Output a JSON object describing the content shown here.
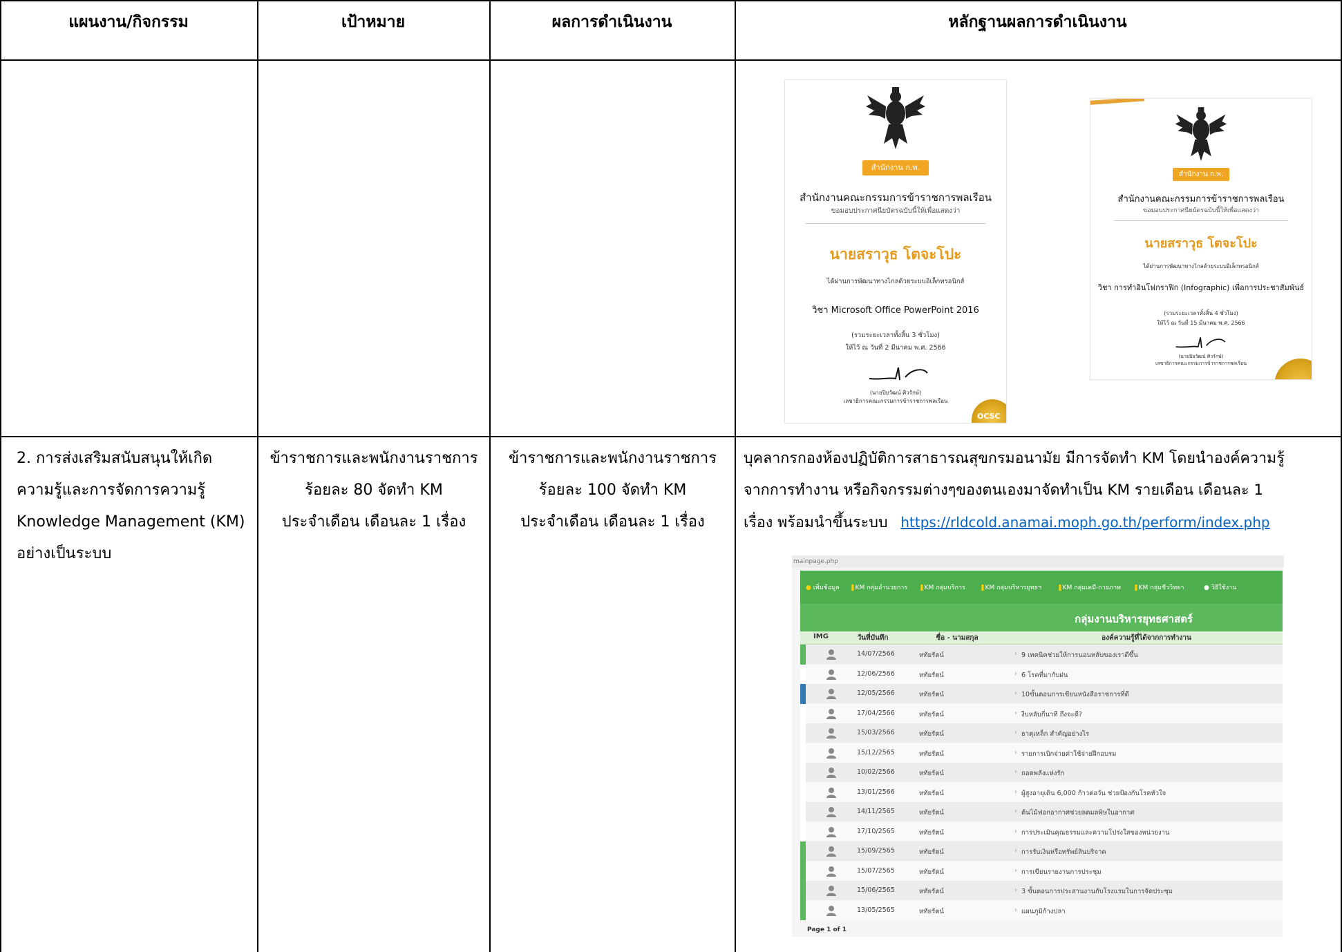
{
  "headers": [
    "แผนงาน/กิจกรรม",
    "เป้าหมาย",
    "ผลการดำเนินงาน",
    "หลักฐานผลการดำเนินงาน"
  ],
  "row2": {
    "plan_lines": [
      "2. การส่งเสริมสนับสนุนให้เกิด",
      "ความรู้และการจัดการความรู้",
      "Knowledge Management (KM)",
      "อย่างเป็นระบบ"
    ],
    "target_lines": [
      "ข้าราชการและพนักงานราชการ",
      "ร้อยละ 80 จัดทำ KM",
      "ประจำเดือน เดือนละ 1 เรื่อง"
    ],
    "result_lines": [
      "ข้าราชการและพนักงานราชการ",
      "ร้อยละ 100 จัดทำ KM",
      "ประจำเดือน เดือนละ 1 เรื่อง"
    ],
    "evidence_lines": [
      "บุคลากรกองห้องปฏิบัติการสาธารณสุขกรมอนามัย มีการจัดทำ KM โดยนำองค์ความรู้",
      "จากการทำงาน หรือกิจกรรมต่างๆของตนเองมาจัดทำเป็น KM รายเดือน เดือนละ 1",
      "เรื่อง พร้อมนำขึ้นระบบ"
    ],
    "evidence_link": "https://rldcold.anamai.moph.go.th/perform/index.php"
  },
  "certificates": [
    {
      "logo": "สำนักงาน ก.พ.",
      "org": "สำนักงานคณะกรรมการข้าราชการพลเรือน",
      "sub": "ขอมอบประกาศนียบัตรฉบับนี้ให้เพื่อแสดงว่า",
      "name": "นายสราวุธ โตจะโปะ",
      "passed": "ได้ผ่านการพัฒนาทางไกลด้วยระบบอิเล็กทรอนิกส์",
      "course": "วิชา Microsoft Office PowerPoint 2016",
      "hours": "(รวมระยะเวลาทั้งสิ้น 3 ชั่วโมง)",
      "date": "ให้ไว้ ณ วันที่ 2 มีนาคม พ.ศ. 2566",
      "signer": "(นายปิยวัฒน์ ศิวรักษ์)",
      "signer_title": "เลขาธิการคณะกรรมการข้าราชการพลเรือน",
      "seal_text": "OCSC"
    },
    {
      "logo": "สำนักงาน ก.พ.",
      "org": "สำนักงานคณะกรรมการข้าราชการพลเรือน",
      "sub": "ขอมอบประกาศนียบัตรฉบับนี้ให้เพื่อแสดงว่า",
      "name": "นายสราวุธ โตจะโปะ",
      "passed": "ได้ผ่านการพัฒนาทางไกลด้วยระบบอิเล็กทรอนิกส์",
      "course": "วิชา การทำอินโฟกราฟิก (Infographic) เพื่อการประชาสัมพันธ์",
      "hours": "(รวมระยะเวลาทั้งสิ้น 4 ชั่วโมง)",
      "date": "ให้ไว้ ณ วันที่ 15 มีนาคม พ.ศ. 2566",
      "signer": "(นายปิยวัฒน์ ศิวรักษ์)",
      "signer_title": "เลขาธิการคณะกรรมการข้าราชการพลเรือน"
    }
  ],
  "screenshot": {
    "url": "mainpage.php",
    "nav": [
      "เพิ่มข้อมูล",
      "KM กลุ่มอำนวยการ",
      "KM กลุ่มบริการ",
      "KM กลุ่มบริหารยุทธฯ",
      "KM กลุ่มเคมี-กายภาพ",
      "KM กลุ่มชีววิทยา",
      "วิธีใช้งาน"
    ],
    "title": "กลุ่มงานบริหารยุทธศาสตร์",
    "columns": [
      "IMG",
      "วันที่บันทึก",
      "ชื่อ - นามสกุล",
      "องค์ความรู้ที่ได้จากการทำงาน"
    ],
    "rows": [
      {
        "date": "14/07/2566",
        "name": "หทัยรัตน์",
        "topic": "9 เทคนิคช่วยให้การนอนหลับของเราดีขึ้น"
      },
      {
        "date": "12/06/2566",
        "name": "หทัยรัตน์",
        "topic": "6 โรคที่มากับฝน"
      },
      {
        "date": "12/05/2566",
        "name": "หทัยรัตน์",
        "topic": "10ขั้นตอนการเขียนหนังสือราชการที่ดี"
      },
      {
        "date": "17/04/2566",
        "name": "หทัยรัตน์",
        "topic": "งีบหลับกี่นาที ถึงจะดี?"
      },
      {
        "date": "15/03/2566",
        "name": "หทัยรัตน์",
        "topic": "ธาตุเหล็ก สำคัญอย่างไร"
      },
      {
        "date": "15/12/2565",
        "name": "หทัยรัตน์",
        "topic": "รายการเบิกจ่ายค่าใช้จ่ายฝึกอบรม"
      },
      {
        "date": "10/02/2566",
        "name": "หทัยรัตน์",
        "topic": "ถอดพลังแห่งรัก"
      },
      {
        "date": "13/01/2566",
        "name": "หทัยรัตน์",
        "topic": "ผู้สูงอายุเดิน 6,000 ก้าวต่อวัน ช่วยป้องกันโรคหัวใจ"
      },
      {
        "date": "14/11/2565",
        "name": "หทัยรัตน์",
        "topic": "ต้นไม้ฟอกอากาศช่วยลดมลพิษในอากาศ"
      },
      {
        "date": "17/10/2565",
        "name": "หทัยรัตน์",
        "topic": "การประเมินคุณธรรมและความโปร่งใสของหน่วยงาน"
      },
      {
        "date": "15/09/2565",
        "name": "หทัยรัตน์",
        "topic": "การรับเงินหรือทรัพย์สินบริจาค"
      },
      {
        "date": "15/07/2565",
        "name": "หทัยรัตน์",
        "topic": "การเขียนรายงานการประชุม"
      },
      {
        "date": "15/06/2565",
        "name": "หทัยรัตน์",
        "topic": "3 ขั้นตอนการประสานงานกับโรงแรมในการจัดประชุม"
      },
      {
        "date": "13/05/2565",
        "name": "หทัยรัตน์",
        "topic": "แผนภูมิก้างปลา"
      }
    ],
    "footer": "Page 1 of 1"
  },
  "colors": {
    "nav_green": "#4cae4c",
    "band_green": "#5cb85c",
    "cert_orange": "#e49a1d",
    "link_blue": "#0563c1"
  }
}
